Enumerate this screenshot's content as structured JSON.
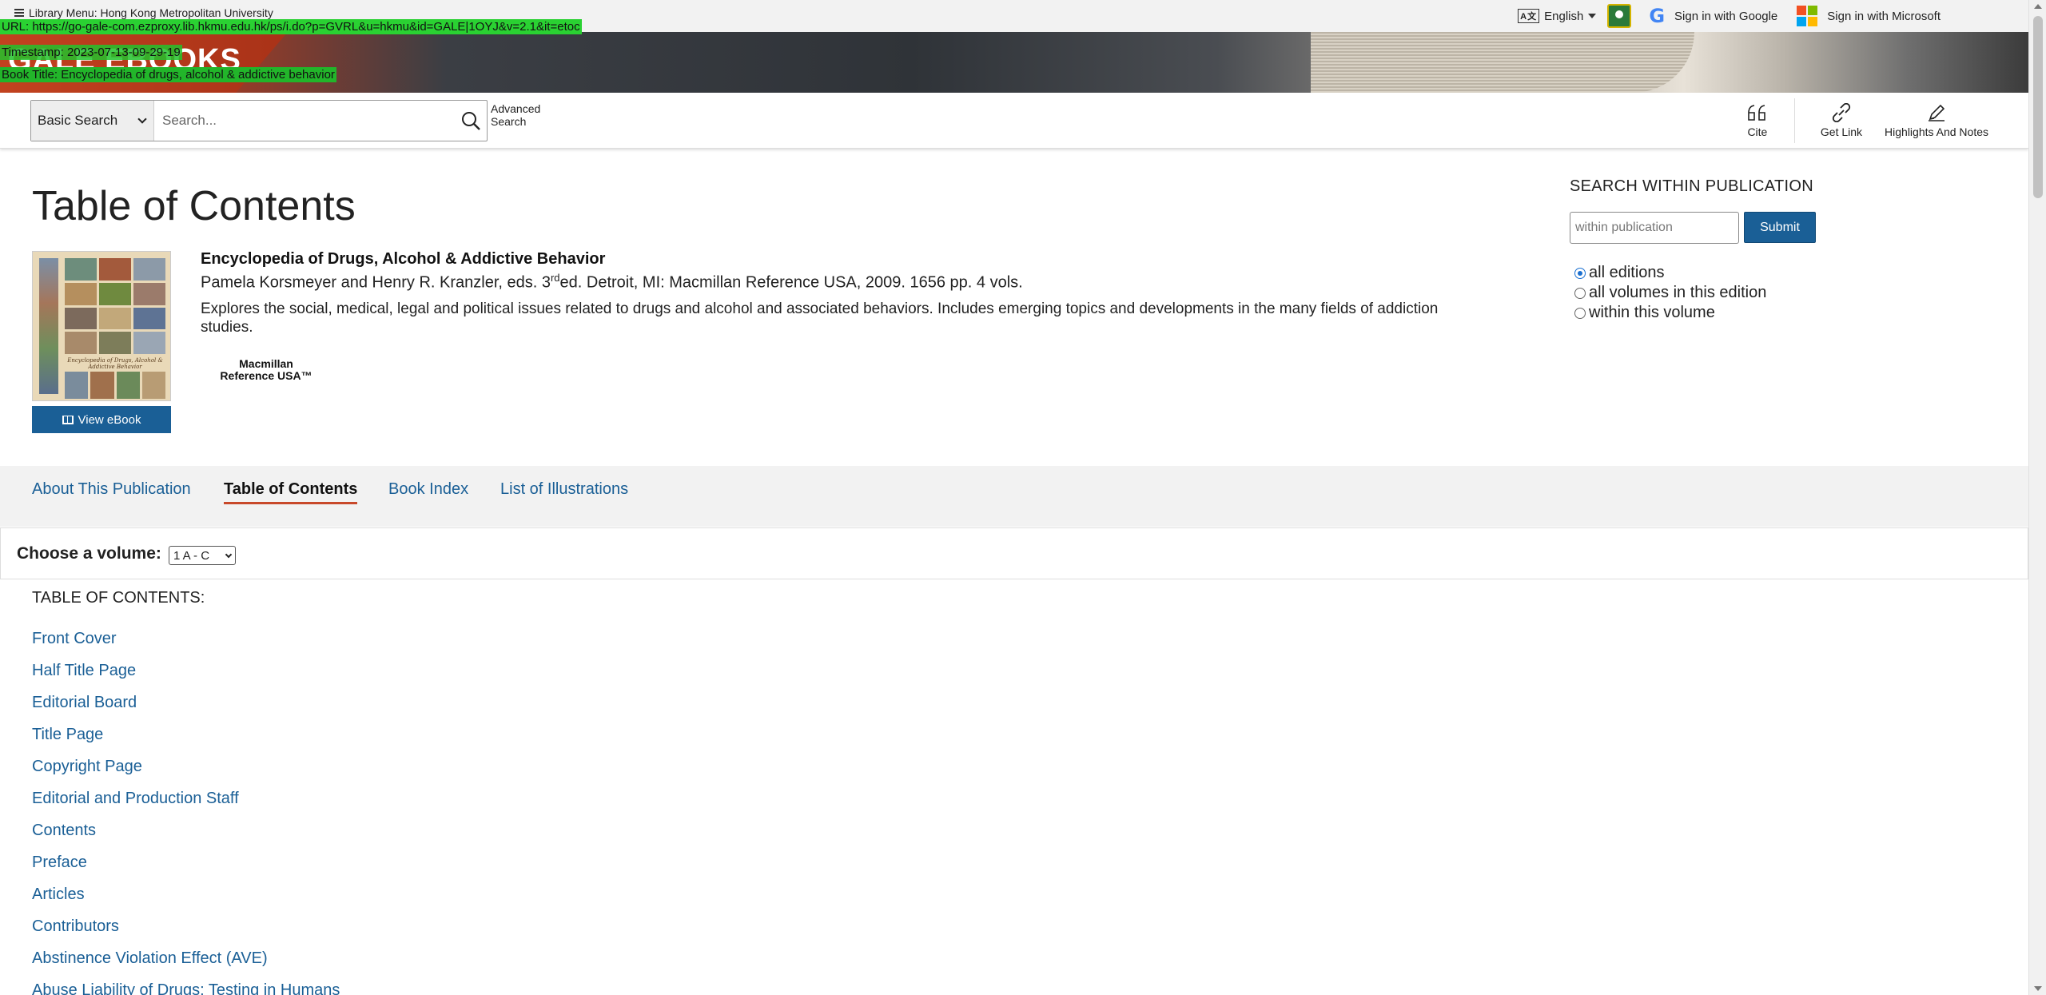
{
  "topbar": {
    "library_menu": "Library Menu: Hong Kong Metropolitan University",
    "language": "English",
    "sign_in_google": "Sign in with Google",
    "sign_in_microsoft": "Sign in with Microsoft"
  },
  "banner": {
    "logo": "GALE EBOOKS"
  },
  "overlay": {
    "url": "URL: https://go-gale-com.ezproxy.lib.hkmu.edu.hk/ps/i.do?p=GVRL&u=hkmu&id=GALE|1OYJ&v=2.1&it=etoc",
    "timestamp": "Timestamp: 2023-07-13-09-29-19",
    "book_title": "Book Title: Encyclopedia of drugs, alcohol & addictive behavior"
  },
  "toolbar": {
    "search_type": "Basic Search",
    "search_placeholder": "Search...",
    "advanced_search": "Advanced Search",
    "tools": {
      "cite": "Cite",
      "get_link": "Get Link",
      "highlights": "Highlights And Notes"
    }
  },
  "main": {
    "page_title": "Table of Contents",
    "view_ebook": "View eBook",
    "publication": {
      "title": "Encyclopedia of Drugs, Alcohol & Addictive Behavior",
      "meta_before": "Pamela Korsmeyer and Henry R. Kranzler, eds. 3",
      "meta_sup": "rd",
      "meta_after": "ed. Detroit, MI: Macmillan Reference USA, 2009. 1656 pp. 4 vols.",
      "description": "Explores the social, medical, legal and political issues related to drugs and alcohol and associated behaviors. Includes emerging topics and developments in the many fields of addiction studies.",
      "publisher_logo": "Macmillan Reference USA™",
      "cover_title": "Encyclopedia of Drugs, Alcohol & Addictive Behavior"
    }
  },
  "search_within": {
    "heading": "SEARCH WITHIN PUBLICATION",
    "placeholder": "within publication",
    "submit": "Submit",
    "options": [
      {
        "label": "all editions",
        "selected": true
      },
      {
        "label": "all volumes in this edition",
        "selected": false
      },
      {
        "label": "within this volume",
        "selected": false
      }
    ]
  },
  "tabs": [
    {
      "label": "About This Publication",
      "active": false
    },
    {
      "label": "Table of Contents",
      "active": true
    },
    {
      "label": "Book Index",
      "active": false
    },
    {
      "label": "List of Illustrations",
      "active": false
    }
  ],
  "volume": {
    "label": "Choose a volume:",
    "selected": "1 A - C"
  },
  "toc": {
    "heading": "TABLE OF CONTENTS:",
    "items": [
      "Front Cover",
      "Half Title Page",
      "Editorial Board",
      "Title Page",
      "Copyright Page",
      "Editorial and Production Staff",
      "Contents",
      "Preface",
      "Articles",
      "Contributors",
      "Abstinence Violation Effect (AVE)",
      "Abuse Liability of Drugs: Testing in Humans"
    ]
  },
  "colors": {
    "link_blue": "#1a5f96",
    "button_blue": "#1a5f96",
    "active_tab_underline": "#c8492a",
    "overlay_green": "#22c22b"
  }
}
